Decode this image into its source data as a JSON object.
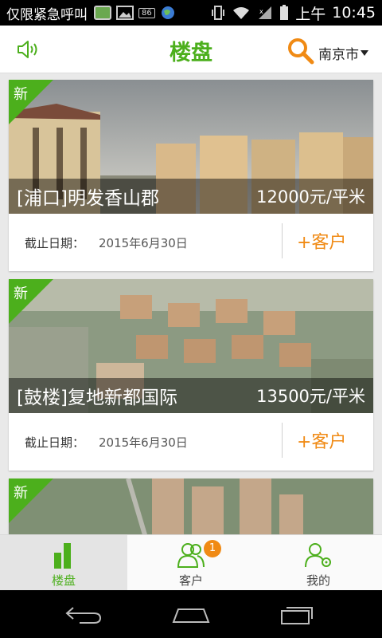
{
  "status_bar": {
    "carrier_text": "仅限紧急呼叫",
    "badge_text": "86",
    "ampm": "上午",
    "time": "10:45"
  },
  "header": {
    "title": "楼盘",
    "city": "南京市",
    "icons": {
      "sound": "speaker-icon",
      "search": "search-icon"
    },
    "colors": {
      "title": "#4caf1c",
      "search": "#f08a14"
    }
  },
  "listings": [
    {
      "ribbon": "新",
      "name": "[浦口]明发香山郡",
      "price": "12000元/平米",
      "deadline_label": "截止日期：",
      "deadline": "2015年6月30日",
      "action": "+客户"
    },
    {
      "ribbon": "新",
      "name": "[鼓楼]复地新都国际",
      "price": "13500元/平米",
      "deadline_label": "截止日期：",
      "deadline": "2015年6月30日",
      "action": "+客户"
    },
    {
      "ribbon": "新"
    }
  ],
  "bottom_nav": {
    "items": [
      {
        "label": "楼盘",
        "icon": "bar-chart-icon",
        "active": true
      },
      {
        "label": "客户",
        "icon": "users-icon",
        "badge": "1"
      },
      {
        "label": "我的",
        "icon": "user-gear-icon"
      }
    ],
    "colors": {
      "active": "#4caf1c",
      "badge": "#f08a14"
    }
  },
  "system_nav": {
    "icons": [
      "back-icon",
      "home-icon",
      "recent-apps-icon"
    ]
  }
}
